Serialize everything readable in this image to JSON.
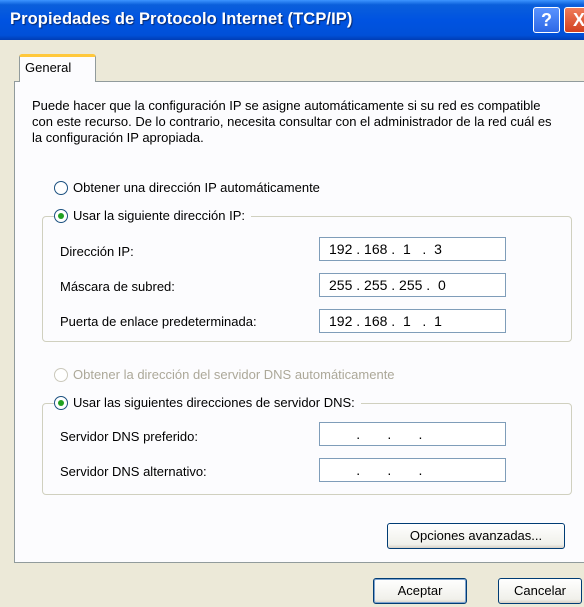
{
  "window": {
    "title": "Propiedades de Protocolo Internet (TCP/IP)",
    "help_glyph": "?",
    "close_glyph": "X"
  },
  "tabs": [
    {
      "label": "General",
      "selected": true
    }
  ],
  "intro_text": "Puede hacer que la configuración IP se asigne automáticamente si su red es compatible con este recurso. De lo contrario, necesita consultar con el administrador de la red cuál es la configuración IP apropiada.",
  "ip_section": {
    "auto_label": "Obtener una dirección IP automáticamente",
    "manual_label": "Usar la siguiente dirección IP:",
    "selected": "manual",
    "fields": [
      {
        "label": "Dirección IP:",
        "value": "192 . 168 .  1   .  3"
      },
      {
        "label": "Máscara de subred:",
        "value": "255 . 255 . 255 .  0"
      },
      {
        "label": "Puerta de enlace predeterminada:",
        "value": "192 . 168 .  1   .  1"
      }
    ]
  },
  "dns_section": {
    "auto_label": "Obtener la dirección del servidor DNS automáticamente",
    "auto_enabled": false,
    "manual_label": "Usar las siguientes direcciones de servidor DNS:",
    "selected": "manual",
    "fields": [
      {
        "label": "Servidor DNS preferido:",
        "value": "       .       .       ."
      },
      {
        "label": "Servidor DNS alternativo:",
        "value": "       .       .       ."
      }
    ]
  },
  "buttons": {
    "advanced": "Opciones avanzadas...",
    "ok": "Aceptar",
    "cancel": "Cancelar"
  },
  "colors": {
    "titlebar": "#0053E1",
    "dialog_bg": "#ECE9D8",
    "tab_highlight": "#FFC83C",
    "radio_dot": "#21A121"
  }
}
